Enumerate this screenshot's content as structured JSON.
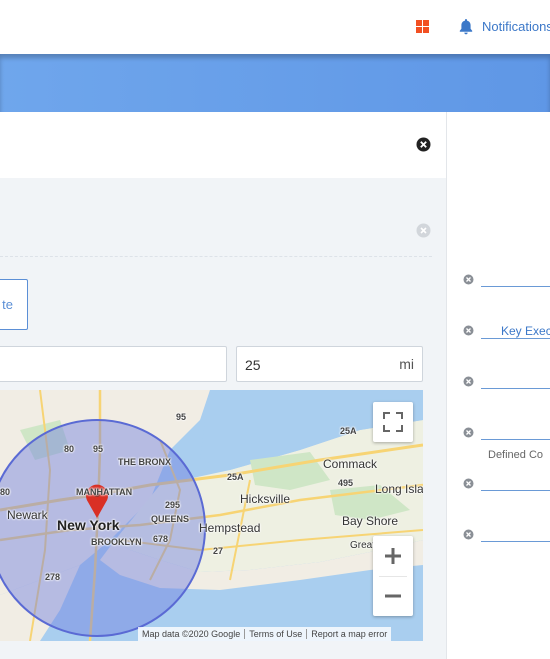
{
  "topbar": {
    "notifications_label": "Notifications"
  },
  "modal": {
    "button_fragment": "te",
    "radius_value": "25",
    "radius_unit": "mi"
  },
  "map": {
    "labels": {
      "new_york": "New York",
      "newark": "Newark",
      "the_bronx": "THE BRONX",
      "manhattan": "MANHATTAN",
      "queens": "QUEENS",
      "brooklyn": "BROOKLYN",
      "hicksville": "Hicksville",
      "hempstead": "Hempstead",
      "commack": "Commack",
      "bay_shore": "Bay Shore",
      "long_island": "Long Isla",
      "great": "Great",
      "r80": "80",
      "r95a": "95",
      "r95b": "95",
      "r80b": "80",
      "r295": "295",
      "r678": "678",
      "r278": "278",
      "r25a1": "25A",
      "r25a2": "25A",
      "r495": "495",
      "r27": "27"
    },
    "attribution": {
      "data": "Map data ©2020 Google",
      "terms": "Terms of Use",
      "report": "Report a map error"
    },
    "circle_radius_mi": 25
  },
  "right_panel": {
    "link_label": "Key Execu",
    "text_label": "Defined Co"
  },
  "colors": {
    "accent": "#5f97e6",
    "link": "#3c78c8",
    "circle": "#6f7ee0"
  }
}
